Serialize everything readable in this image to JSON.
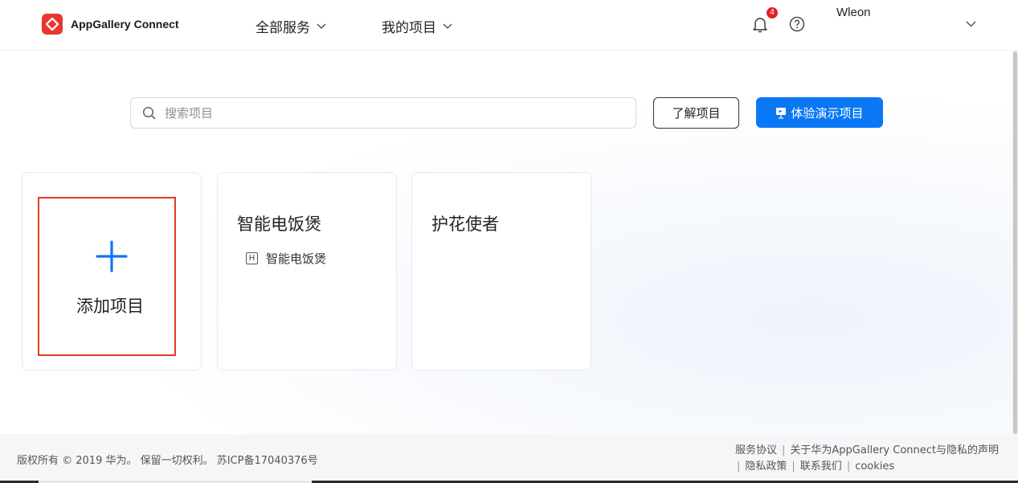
{
  "header": {
    "app_name": "AppGallery Connect",
    "nav": {
      "all_services": "全部服务",
      "my_projects": "我的项目"
    },
    "notification_count": "4",
    "username": "Wleon"
  },
  "toolbar": {
    "search_placeholder": "搜索项目",
    "learn_label": "了解项目",
    "demo_label": "体验演示项目"
  },
  "projects": {
    "add_label": "添加项目",
    "items": [
      {
        "name": "智能电饭煲",
        "app_badge": "H",
        "app_name": "智能电饭煲"
      },
      {
        "name": "护花使者"
      }
    ]
  },
  "footer": {
    "copyright": "版权所有 © 2019 华为。 保留一切权利。 苏ICP备17040376号",
    "links": {
      "service_agreement": "服务协议",
      "privacy_statement": "关于华为AppGallery Connect与隐私的声明",
      "privacy_policy": "隐私政策",
      "contact_us": "联系我们",
      "cookies": "cookies"
    }
  },
  "colors": {
    "brand_red": "#e8372f",
    "primary_blue": "#0a78f5",
    "highlight_box": "#e33a1f",
    "badge_red": "#e4202b"
  },
  "icons": [
    "huawei-logo-icon",
    "chevron-down-icon",
    "bell-icon",
    "help-icon",
    "search-icon",
    "presentation-icon",
    "plus-icon"
  ]
}
